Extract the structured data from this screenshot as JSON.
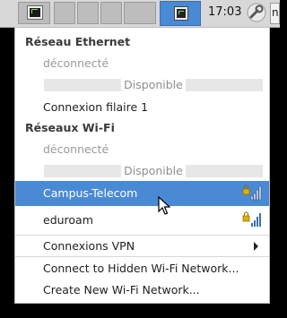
{
  "panel": {
    "clock": "17:03",
    "user_letter": "n"
  },
  "menu": {
    "ethernet_header": "Réseau Ethernet",
    "ethernet_status": "déconnecté",
    "ethernet_available": "Disponible",
    "ethernet_connection": "Connexion filaire 1",
    "wifi_header": "Réseaux Wi-Fi",
    "wifi_status": "déconnecté",
    "wifi_available": "Disponible",
    "networks": [
      {
        "ssid": "Campus-Telecom",
        "selected": true
      },
      {
        "ssid": "eduroam",
        "selected": false
      }
    ],
    "vpn": "Connexions VPN",
    "hidden_wifi": "Connect to Hidden Wi-Fi Network...",
    "new_wifi": "Create New Wi-Fi Network..."
  },
  "colors": {
    "selection": "#4a8ad4",
    "lock": "#e0b000",
    "signal": "#3b6fb0"
  }
}
